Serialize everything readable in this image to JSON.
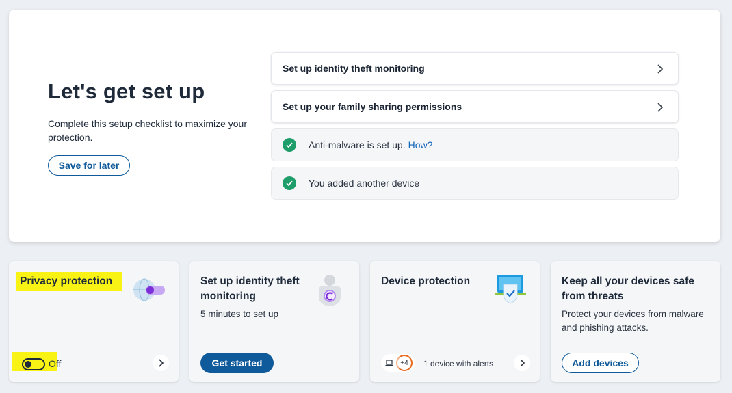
{
  "setup": {
    "title": "Let's get set up",
    "description": "Complete this setup checklist to maximize your protection.",
    "save_label": "Save for later",
    "items": [
      {
        "label": "Set up identity theft monitoring",
        "status": "todo"
      },
      {
        "label": "Set up your family sharing permissions",
        "status": "todo"
      },
      {
        "label": "Anti-malware is set up.",
        "link": "How?",
        "status": "done"
      },
      {
        "label": "You added another device",
        "status": "done"
      }
    ]
  },
  "tiles": {
    "privacy": {
      "title": "Privacy protection",
      "toggle_state": "Off",
      "icon": "globe-toggle-icon"
    },
    "identity": {
      "title": "Set up identity theft monitoring",
      "subtitle": "5 minutes to set up",
      "button": "Get started",
      "icon": "identity-shield-icon"
    },
    "device": {
      "title": "Device protection",
      "alert_count": "+4",
      "alert_text": "1 device with alerts",
      "icon": "laptop-shield-icon"
    },
    "devices_safe": {
      "title": "Keep all your devices safe from threats",
      "subtitle": "Protect your devices from malware and phishing attacks.",
      "button": "Add devices"
    }
  },
  "colors": {
    "accent": "#0f5a9a",
    "success": "#1f9d6b",
    "highlight": "#f8f215",
    "alert": "#e86a1e"
  }
}
